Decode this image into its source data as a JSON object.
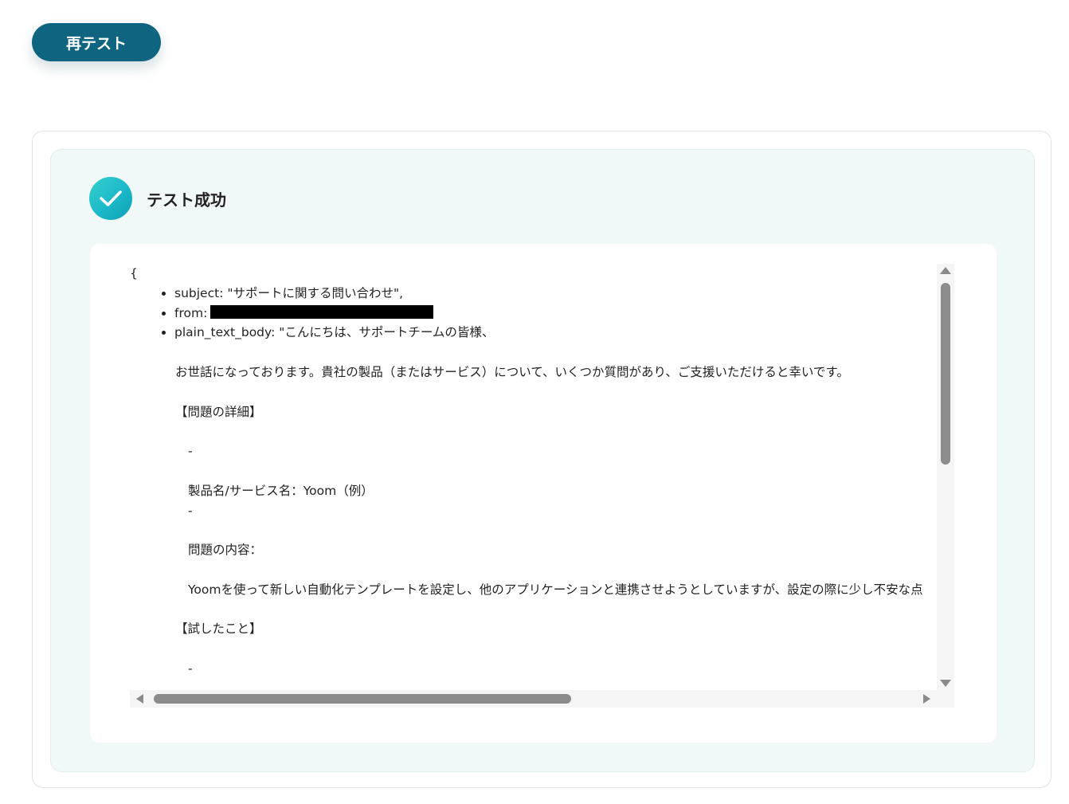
{
  "toolbar": {
    "retest_label": "再テスト"
  },
  "status": {
    "title": "テスト成功",
    "icon": "check-icon",
    "accent": "#1bb8c9"
  },
  "output": {
    "open_brace": "{",
    "fields": [
      {
        "key": "subject",
        "value": "\"サポートに関する問い合わせ\","
      },
      {
        "key": "from",
        "value": ""
      },
      {
        "key": "plain_text_body",
        "value": "\"こんにちは、サポートチームの皆様、"
      }
    ],
    "body_lines": [
      "お世話になっております。貴社の製品（またはサービス）について、いくつか質問があり、ご支援いただけると幸いです。",
      "【問題の詳細】",
      "-",
      "製品名/サービス名：Yoom（例）",
      "-",
      "問題の内容：",
      "Yoomを使って新しい自動化テンプレートを設定し、他のアプリケーションと連携させようとしていますが、設定の際に少し不安な点",
      "【試したこと】",
      "-"
    ]
  },
  "colors": {
    "button_bg": "#0f6480",
    "panel_bg": "#f1f9f8"
  }
}
